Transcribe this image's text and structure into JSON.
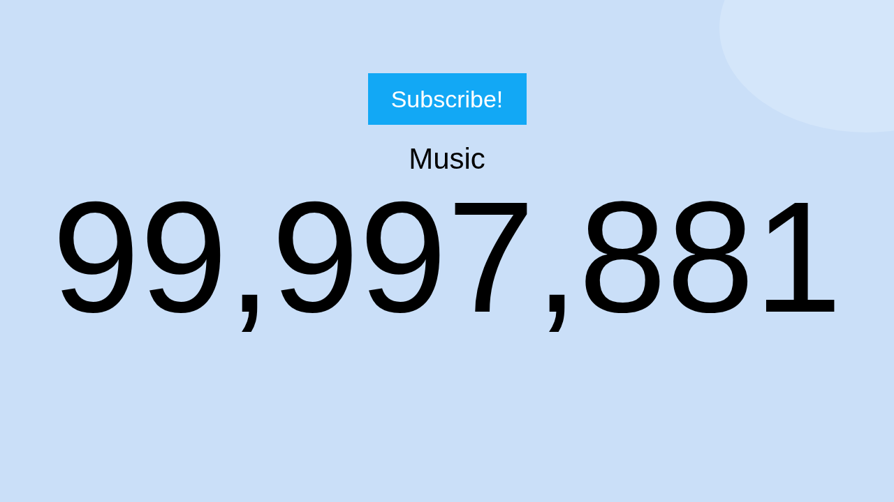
{
  "subscribe_button": {
    "label": "Subscribe!"
  },
  "channel": {
    "name": "Music"
  },
  "subscriber_count": "99,997,881"
}
